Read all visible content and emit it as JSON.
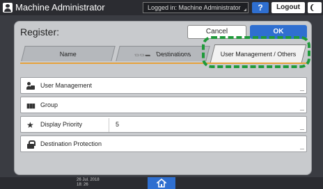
{
  "topbar": {
    "title": "Machine Administrator",
    "login_status": "Logged in: Machine Administrator",
    "help_label": "?",
    "logout_label": "Logout",
    "icons": {
      "user": "user-icon",
      "help": "help-icon",
      "sleep": "moon-icon"
    }
  },
  "panel": {
    "title": "Register:",
    "cancel_label": "Cancel",
    "ok_label": "OK",
    "tabs": [
      {
        "label": "Name",
        "selected": false
      },
      {
        "label": "Destinations",
        "selected": false,
        "icon": "destination-type-icons"
      },
      {
        "label": "User Management / Others",
        "selected": true
      }
    ],
    "rows": [
      {
        "label": "User Management",
        "value": "",
        "icon": "user-lock-icon"
      },
      {
        "label": "Group",
        "value": "",
        "icon": "group-icon"
      },
      {
        "label": "Display Priority",
        "value": "5",
        "icon": "star-icon"
      },
      {
        "label": "Destination Protection",
        "value": "",
        "icon": "lock-icon"
      }
    ]
  },
  "bottombar": {
    "date": "26 Jul. 2018",
    "time": "18: 26",
    "home_icon": "home-icon"
  },
  "colors": {
    "accent_blue": "#2f6fd0",
    "tab_underline": "#e7a23a",
    "highlight_green": "#1f9a3a",
    "bar_dark": "#2b2c31"
  }
}
